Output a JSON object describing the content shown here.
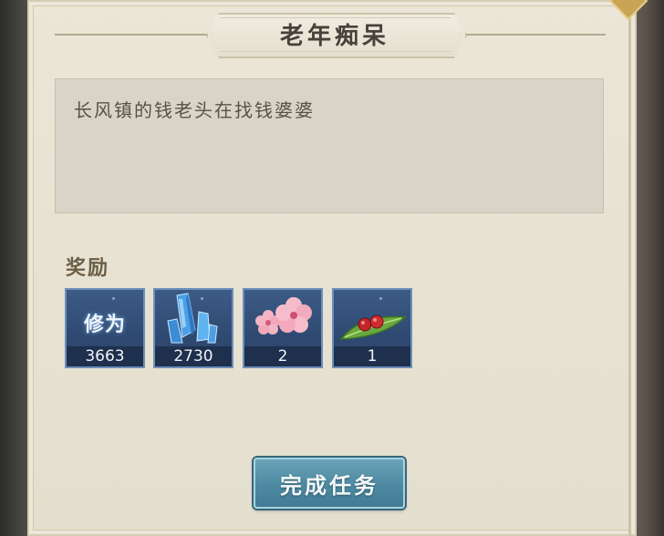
{
  "dialog": {
    "title": "老年痴呆",
    "description": "长风镇的钱老头在找钱婆婆",
    "reward_label": "奖励",
    "complete_button": "完成任务"
  },
  "rewards": [
    {
      "name": "修为",
      "icon": "xiuwei-icon",
      "count": "3663"
    },
    {
      "name": "",
      "icon": "blue-crystal-icon",
      "count": "2730"
    },
    {
      "name": "",
      "icon": "peach-blossom-icon",
      "count": "2"
    },
    {
      "name": "",
      "icon": "red-berries-on-leaf-icon",
      "count": "1"
    }
  ],
  "colors": {
    "panel": "#e7e2d2",
    "description_box": "#d8d4c7",
    "slot": "#2f4a72",
    "button": "#4d8aa2",
    "title_text": "#46413a"
  }
}
